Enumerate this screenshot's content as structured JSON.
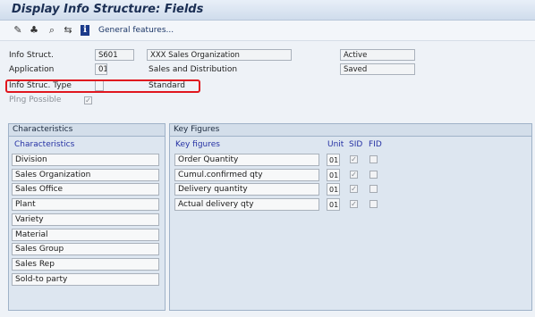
{
  "window": {
    "title": "Display Info Structure: Fields"
  },
  "toolbar": {
    "icons": [
      "pencil-icon",
      "hierarchy-icon",
      "find-icon",
      "swap-icon",
      "info-icon"
    ],
    "info_glyph": "i",
    "general_features": "General features..."
  },
  "header": {
    "info_struct_label": "Info Struct.",
    "info_struct_value": "S601",
    "info_struct_desc": "XXX Sales Organization",
    "status_active": "Active",
    "application_label": "Application",
    "application_value": "01",
    "application_desc": "Sales and Distribution",
    "status_saved": "Saved",
    "info_struc_type_label": "Info Struc. Type",
    "info_struc_type_value": "Standard",
    "planning_possible_label": "Plng Possible",
    "planning_possible_checked": true
  },
  "characteristics": {
    "panel_title": "Characteristics",
    "column_header": "Characteristics",
    "items": [
      "Division",
      "Sales Organization",
      "Sales Office",
      "Plant",
      "Variety",
      "Material",
      "Sales Group",
      "Sales Rep",
      "Sold-to party"
    ]
  },
  "key_figures": {
    "panel_title": "Key Figures",
    "column_header": "Key figures",
    "unit_header": "Unit",
    "sid_header": "SID",
    "fid_header": "FID",
    "items": [
      {
        "name": "Order Quantity",
        "unit": "01",
        "sid": true,
        "fid": false
      },
      {
        "name": "Cumul.confirmed qty",
        "unit": "01",
        "sid": true,
        "fid": false
      },
      {
        "name": "Delivery quantity",
        "unit": "01",
        "sid": true,
        "fid": false
      },
      {
        "name": "Actual delivery qty",
        "unit": "01",
        "sid": true,
        "fid": false
      }
    ]
  },
  "colors": {
    "highlight": "#e0161e",
    "header_text": "#1b2f54",
    "column_header": "#2632a4"
  }
}
